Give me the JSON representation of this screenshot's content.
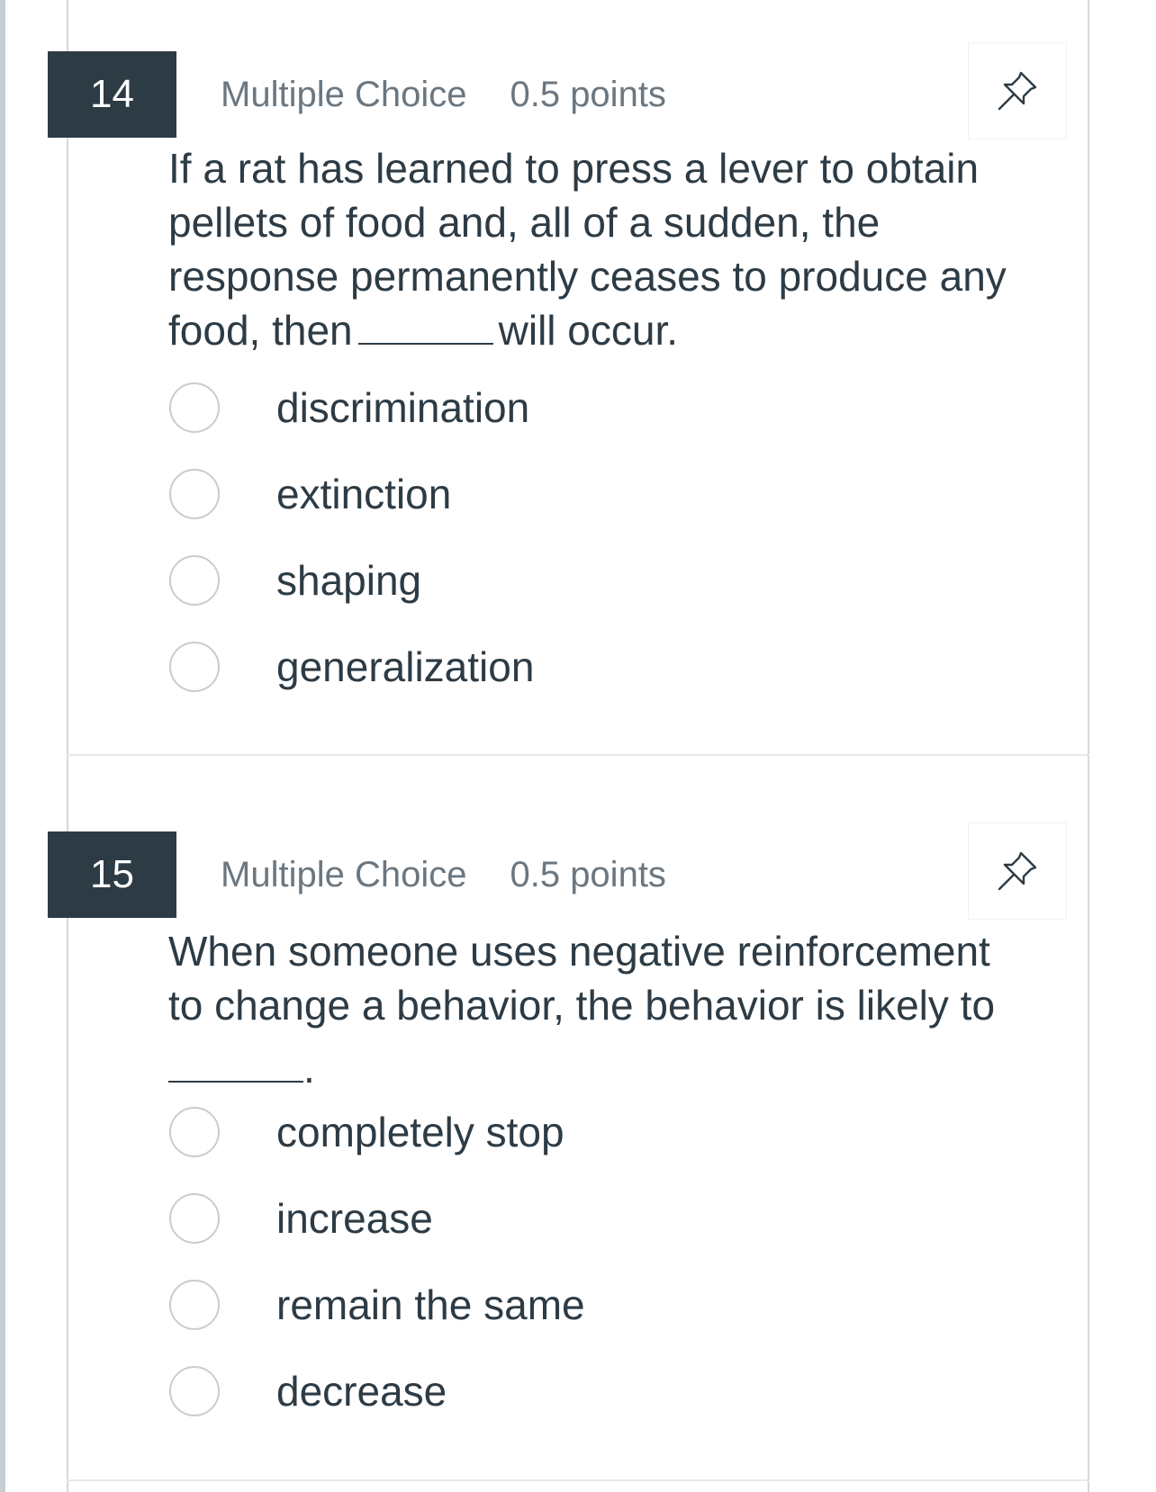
{
  "questions": [
    {
      "number": "14",
      "type": "Multiple Choice",
      "points": "0.5 points",
      "text_lines": [
        "If a rat has learned to press a lever to obtain",
        "pellets of food and, all of a sudden, the",
        "response permanently ceases to produce any",
        "food, then",
        "will occur."
      ],
      "answers": [
        "discrimination",
        "extinction",
        "shaping",
        "generalization"
      ]
    },
    {
      "number": "15",
      "type": "Multiple Choice",
      "points": "0.5 points",
      "text_lines": [
        "When someone uses negative reinforcement",
        "to change a behavior, the behavior is likely to",
        "."
      ],
      "answers": [
        "completely stop",
        "increase",
        "remain the same",
        "decrease"
      ]
    }
  ],
  "icons": {
    "pin": "pin-icon",
    "radio": "radio-empty"
  },
  "colors": {
    "number_badge_bg": "#2d3b45",
    "text": "#2d3b45",
    "meta_text": "#6b7780",
    "radio_border": "#c7cdd1"
  }
}
